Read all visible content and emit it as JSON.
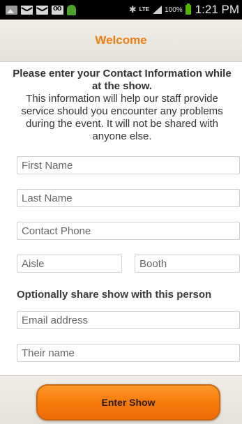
{
  "status_bar": {
    "icons_left": [
      "image-icon",
      "mail-icon",
      "mail-icon",
      "voicemail-icon",
      "android-icon"
    ],
    "network": "LTE",
    "battery_percent": "100%",
    "time": "1:21 PM"
  },
  "header": {
    "title": "Welcome"
  },
  "intro": {
    "heading": "Please enter your Contact Information while at the show.",
    "body": "This information will help our staff provide service should you encounter any problems during the event. It will not be shared with anyone else."
  },
  "form": {
    "first_name": {
      "placeholder": "First Name",
      "value": ""
    },
    "last_name": {
      "placeholder": "Last Name",
      "value": ""
    },
    "contact_phone": {
      "placeholder": "Contact Phone",
      "value": ""
    },
    "aisle": {
      "placeholder": "Aisle",
      "value": ""
    },
    "booth": {
      "placeholder": "Booth",
      "value": ""
    },
    "share_label": "Optionally share show with this person",
    "email": {
      "placeholder": "Email address",
      "value": ""
    },
    "their_name": {
      "placeholder": "Their name",
      "value": ""
    }
  },
  "footer": {
    "enter_label": "Enter Show"
  },
  "colors": {
    "accent": "#f07d10",
    "button": "#f77d0e",
    "battery": "#52b500"
  }
}
